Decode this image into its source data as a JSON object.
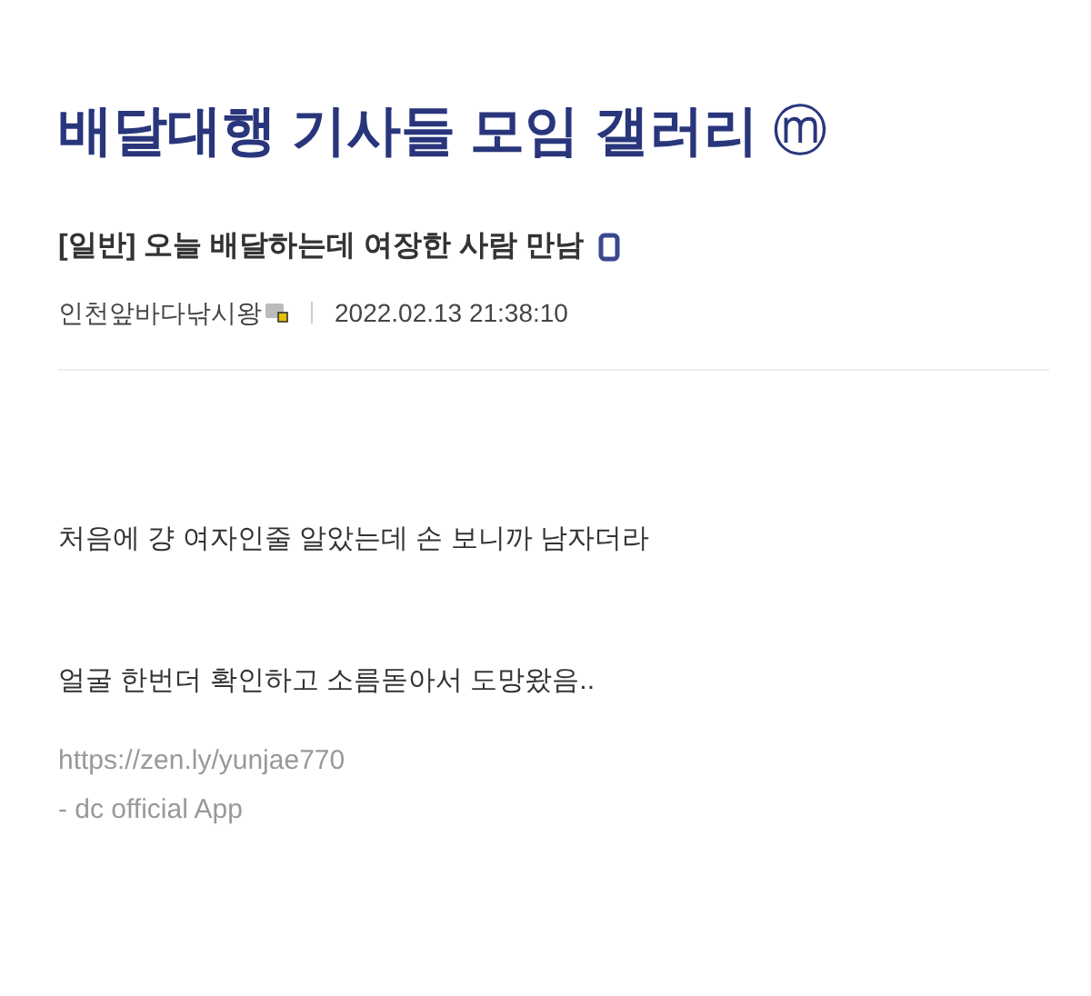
{
  "gallery": {
    "title": "배달대행 기사들 모임 갤러리",
    "badge": "ⓜ"
  },
  "post": {
    "category": "[일반]",
    "title": "오늘 배달하는데 여장한 사람 만남",
    "author": "인천앞바다낚시왕",
    "date": "2022.02.13 21:38:10",
    "body": [
      "처음에 걍 여자인줄 알았는데 손 보니까 남자더라",
      "얼굴 한번더 확인하고 소름돋아서 도망왔음.."
    ],
    "signature": [
      "https://zen.ly/yunjae770",
      "- dc official App"
    ]
  }
}
